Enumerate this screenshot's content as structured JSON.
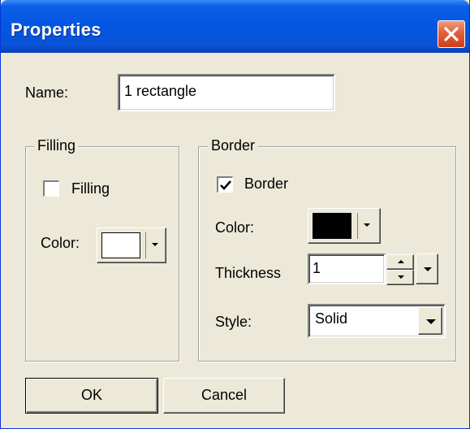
{
  "window": {
    "title": "Properties"
  },
  "name_field": {
    "label": "Name:",
    "value": "1 rectangle"
  },
  "filling": {
    "group_label": "Filling",
    "checkbox_label": "Filling",
    "checked": false,
    "color_label": "Color:",
    "color": "#ffffff"
  },
  "border": {
    "group_label": "Border",
    "checkbox_label": "Border",
    "checked": true,
    "color_label": "Color:",
    "color": "#000000",
    "thickness_label": "Thickness",
    "thickness_value": "1",
    "style_label": "Style:",
    "style_value": "Solid"
  },
  "buttons": {
    "ok": "OK",
    "cancel": "Cancel"
  },
  "colors": {
    "titlebar": "#0456e2",
    "dialog_bg": "#ece9d8",
    "close": "#e0603c"
  },
  "icons": {
    "close": "close-icon",
    "check": "checkmark-icon",
    "dropdown": "chevron-down-icon"
  }
}
